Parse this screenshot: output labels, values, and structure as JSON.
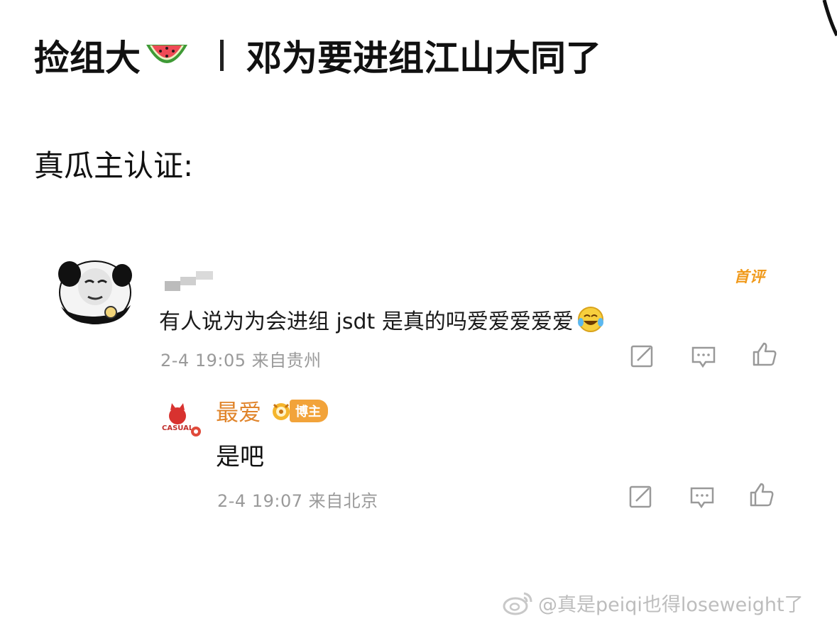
{
  "headline": {
    "left": "捡组大",
    "right": "邓为要进组江山大同了"
  },
  "subhead": "真瓜主认证:",
  "comment": {
    "badge": "首评",
    "text": "有人说为为会进组 jsdt 是真的吗爱爱爱爱爱",
    "meta": "2-4 19:05 来自贵州",
    "icons": [
      "share-icon",
      "reply-icon",
      "like-icon"
    ]
  },
  "reply": {
    "user": "最爱",
    "author_badge": "博主",
    "avatar_text": "CASUAL",
    "text": "是吧",
    "meta": "2-4 19:07 来自北京"
  },
  "watermark": "@真是peiqi也得loseweight了",
  "colors": {
    "accent_orange": "#f09a1c",
    "reply_name": "#e0842a",
    "meta_gray": "#9a9a9a",
    "watermark_gray": "#bdbdbd"
  }
}
